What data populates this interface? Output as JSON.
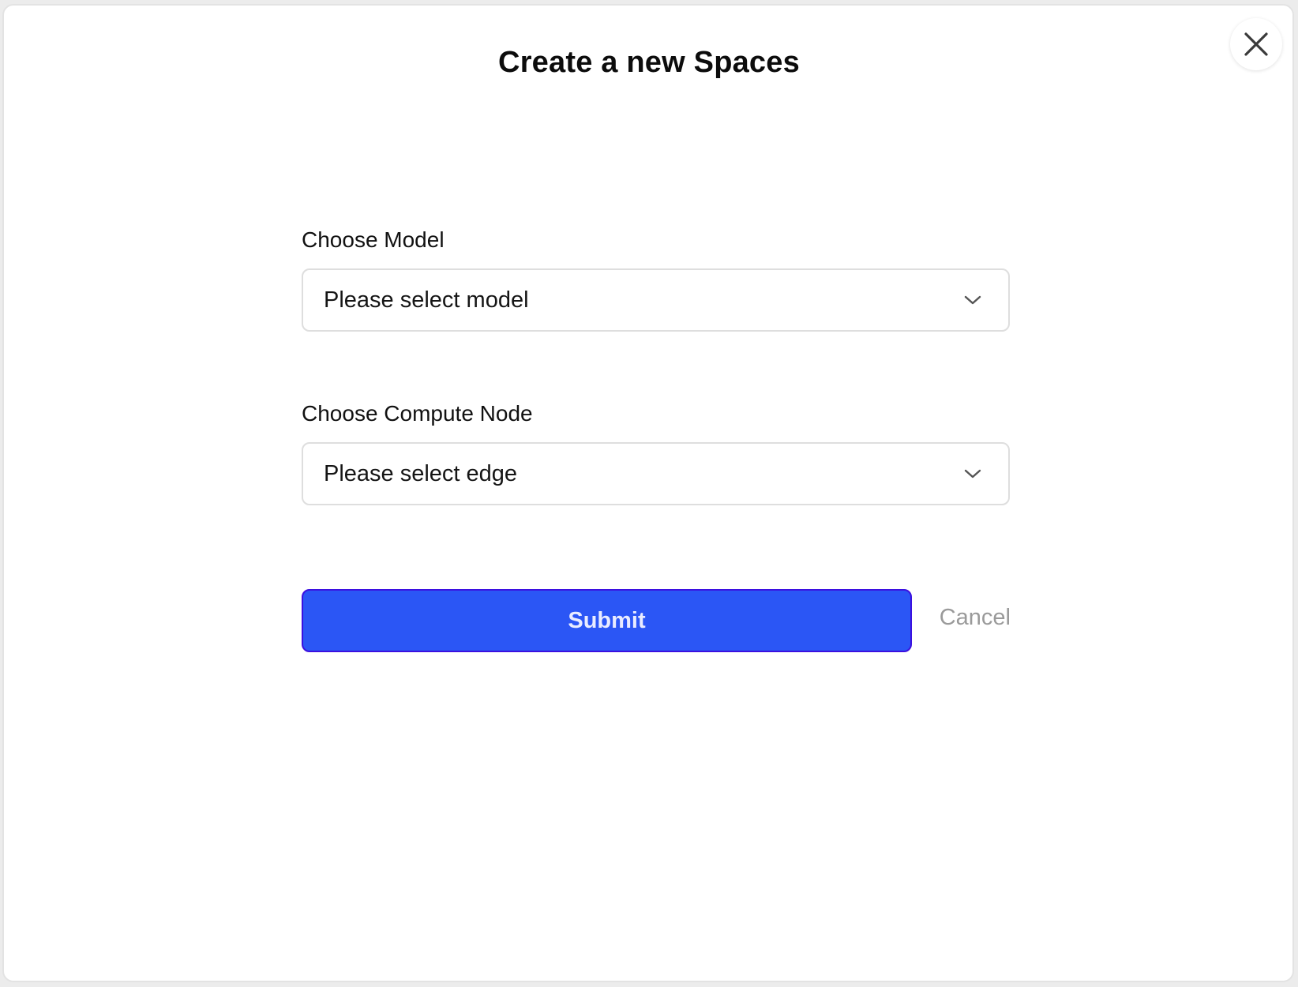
{
  "dialog": {
    "title": "Create a new Spaces",
    "close_icon": "close-icon"
  },
  "model": {
    "label": "Choose Model",
    "selected": "Please select model",
    "icon": "chevron-down-icon"
  },
  "compute_node": {
    "label": "Choose Compute Node",
    "selected": "Please select edge",
    "icon": "chevron-down-icon"
  },
  "actions": {
    "submit_label": "Submit",
    "cancel_label": "Cancel"
  },
  "colors": {
    "accent": "#2b56f5",
    "accent_border": "#3b10e0",
    "muted_text": "#9a9a9a"
  }
}
